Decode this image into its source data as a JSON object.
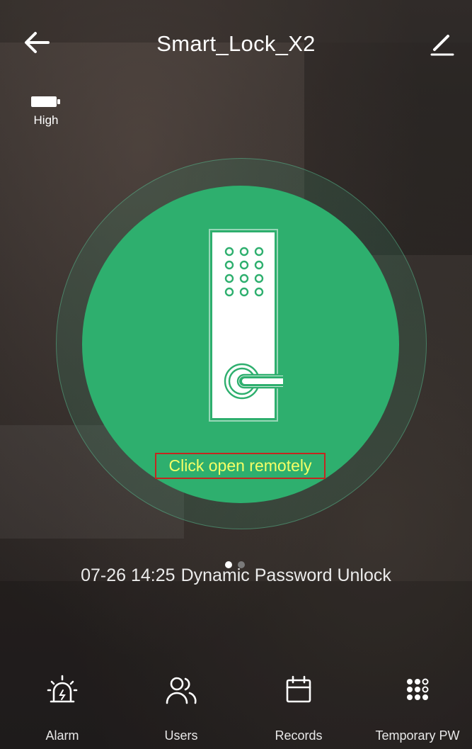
{
  "header": {
    "title": "Smart_Lock_X2",
    "back_icon": "arrow-left-icon",
    "edit_icon": "pencil-icon"
  },
  "battery": {
    "icon": "battery-icon",
    "level_label": "High"
  },
  "unlock": {
    "button_label": "Click open remotely",
    "circle_color": "#2eaf6e",
    "label_color": "#f5ff66",
    "highlight_border_color": "#c4261f"
  },
  "pager": {
    "total": 2,
    "active_index": 0
  },
  "last_record": {
    "time": "07-26 14:25",
    "event": "Dynamic Password Unlock"
  },
  "bottom_nav": {
    "items": [
      {
        "label": "Alarm",
        "icon": "alarm-icon"
      },
      {
        "label": "Users",
        "icon": "users-icon"
      },
      {
        "label": "Records",
        "icon": "calendar-icon"
      },
      {
        "label": "Temporary PW",
        "icon": "keypad-icon"
      }
    ]
  }
}
